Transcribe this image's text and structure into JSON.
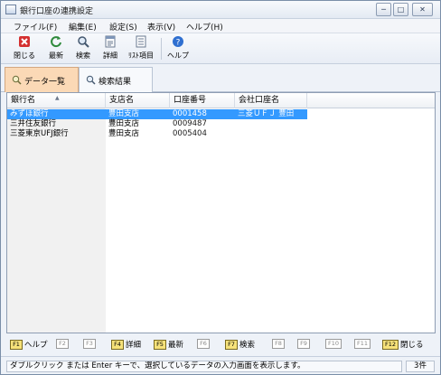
{
  "window": {
    "title": "銀行口座の連携設定",
    "minimize": "─",
    "maximize": "□",
    "close": "✕"
  },
  "menu": [
    "ファイル(F)",
    "編集(E)",
    "設定(S)",
    "表示(V)",
    "ヘルプ(H)"
  ],
  "toolbar": {
    "close_label": "閉じる",
    "refresh_label": "最新",
    "search_label": "検索",
    "detail_label": "詳細",
    "list_items_label": "ﾘｽﾄ項目",
    "help_label": "ヘルプ",
    "colors": {
      "close": "#d43030",
      "refresh": "#2f8a3c",
      "help": "#2f6fd0"
    }
  },
  "tabs": [
    {
      "label": "データ一覧",
      "active": true
    },
    {
      "label": "検索結果",
      "active": false
    }
  ],
  "grid": {
    "columns": [
      "銀行名",
      "支店名",
      "口座番号",
      "会社口座名"
    ],
    "sort_indicator": "▲",
    "rows": [
      {
        "bank": "みずほ銀行",
        "branch": "豊田支店",
        "account": "0001458",
        "company_account": "三菱ＵＦＪ 豊田",
        "selected": true
      },
      {
        "bank": "三井住友銀行",
        "branch": "豊田支店",
        "account": "0009487",
        "company_account": "",
        "selected": false
      },
      {
        "bank": "三菱東京UFJ銀行",
        "branch": "豊田支店",
        "account": "0005404",
        "company_account": "",
        "selected": false
      }
    ]
  },
  "fkeys": [
    {
      "key": "F1",
      "label": "ヘルプ",
      "enabled": true
    },
    {
      "key": "F2",
      "label": "",
      "enabled": false
    },
    {
      "key": "F3",
      "label": "",
      "enabled": false
    },
    {
      "key": "F4",
      "label": "詳細",
      "enabled": true
    },
    {
      "key": "F5",
      "label": "最新",
      "enabled": true
    },
    {
      "key": "F6",
      "label": "",
      "enabled": false
    },
    {
      "key": "F7",
      "label": "検索",
      "enabled": true
    },
    {
      "key": "F8",
      "label": "",
      "enabled": false
    },
    {
      "key": "F9",
      "label": "",
      "enabled": false
    },
    {
      "key": "F10",
      "label": "",
      "enabled": false
    },
    {
      "key": "F11",
      "label": "",
      "enabled": false
    },
    {
      "key": "F12",
      "label": "閉じる",
      "enabled": true
    }
  ],
  "status": {
    "message": "ダブルクリック または Enter キーで、選択しているデータの入力画面を表示します。",
    "count": "3件"
  }
}
